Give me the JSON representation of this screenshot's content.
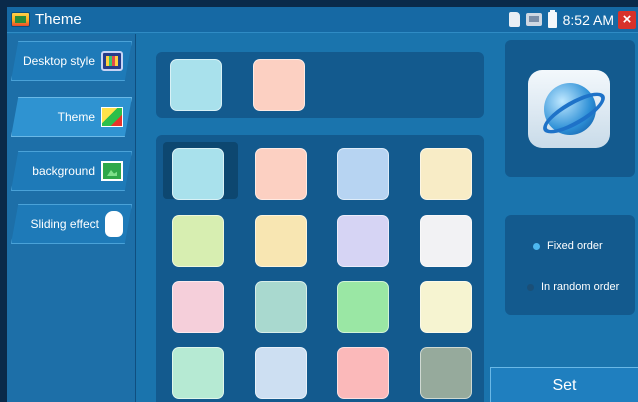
{
  "window": {
    "title": "Theme",
    "time": "8:52 AM",
    "close_glyph": "×"
  },
  "sidebar": {
    "items": [
      {
        "label": "Desktop style",
        "icon": "desktop-style-icon"
      },
      {
        "label": "Theme",
        "icon": "theme-icon",
        "active": true
      },
      {
        "label": "background",
        "icon": "background-picture-icon"
      },
      {
        "label": "Sliding effect",
        "icon": "hand-pointer-icon"
      }
    ]
  },
  "preview": {
    "colors": [
      "#a9e1ec",
      "#fcd0c2"
    ]
  },
  "themes": {
    "selected_index": 0,
    "colors": [
      "#a9e1ec",
      "#fcd0c2",
      "#b7d4f2",
      "#f8ecc6",
      "#d7eeb1",
      "#f8e6b2",
      "#d6d4f4",
      "#f2f2f4",
      "#f5cfda",
      "#a9d9cf",
      "#9ae7a4",
      "#f6f4d1",
      "#b6ead3",
      "#cddff2",
      "#fbb9ba",
      "#96aa9c"
    ]
  },
  "order": {
    "options": [
      {
        "label": "Fixed order",
        "selected": true
      },
      {
        "label": "In random order",
        "selected": false
      }
    ]
  },
  "set_button": {
    "label": "Set"
  },
  "colors": {
    "panel_bg": "#1a74ad",
    "inner_panel": "#135a8e",
    "accent": "#4db8f0",
    "close_red": "#d8322a"
  }
}
